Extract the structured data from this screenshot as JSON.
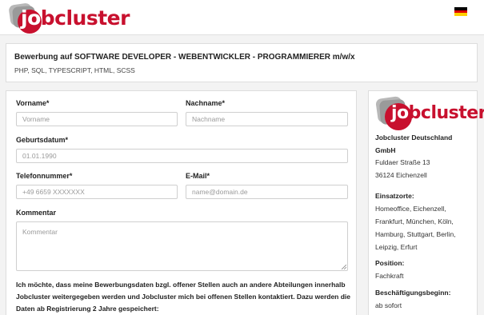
{
  "header": {
    "logo_text_jo": "jo",
    "logo_text_rest": "bcluster",
    "language_flag": "de-flag-icon"
  },
  "job": {
    "title": "Bewerbung auf SOFTWARE DEVELOPER - WEBENTWICKLER - PROGRAMMIERER m/w/x",
    "skills": "PHP, SQL, TYPESCRIPT, HTML, SCSS"
  },
  "form": {
    "first_name": {
      "label": "Vorname*",
      "placeholder": "Vorname",
      "value": ""
    },
    "last_name": {
      "label": "Nachname*",
      "placeholder": "Nachname",
      "value": ""
    },
    "birthdate": {
      "label": "Geburtsdatum*",
      "placeholder": "01.01.1990",
      "value": ""
    },
    "phone": {
      "label": "Telefonnummer*",
      "placeholder": "+49 6659 XXXXXXX",
      "value": ""
    },
    "email": {
      "label": "E-Mail*",
      "placeholder": "name@domain.de",
      "value": ""
    },
    "comment": {
      "label": "Kommentar",
      "placeholder": "Kommentar",
      "value": ""
    },
    "consent_text": "Ich möchte, dass meine Bewerbungsdaten bzgl. offener Stellen auch an andere Abteilungen innerhalb Jobcluster weitergegeben werden und Jobcluster mich bei offenen Stellen kontaktiert. Dazu werden die Daten ab Registrierung 2 Jahre gespeichert:"
  },
  "company": {
    "logo_text_jo": "jo",
    "logo_text_rest": "bcluster",
    "name_line1": "Jobcluster Deutschland",
    "name_line2": "GmbH",
    "street": "Fuldaer Straße 13",
    "city": "36124 Eichenzell",
    "locations_label": "Einsatzorte:",
    "locations_lines": [
      "Homeoffice, Eichenzell,",
      "Frankfurt, München, Köln,",
      "Hamburg, Stuttgart, Berlin,",
      "Leipzig, Erfurt"
    ],
    "position_label": "Position:",
    "position_value": "Fachkraft",
    "start_label": "Beschäftigungsbeginn:",
    "start_value": "ab sofort"
  },
  "colors": {
    "brand_red": "#c8102e",
    "page_background": "#f3f3f3",
    "card_background": "#ffffff"
  }
}
